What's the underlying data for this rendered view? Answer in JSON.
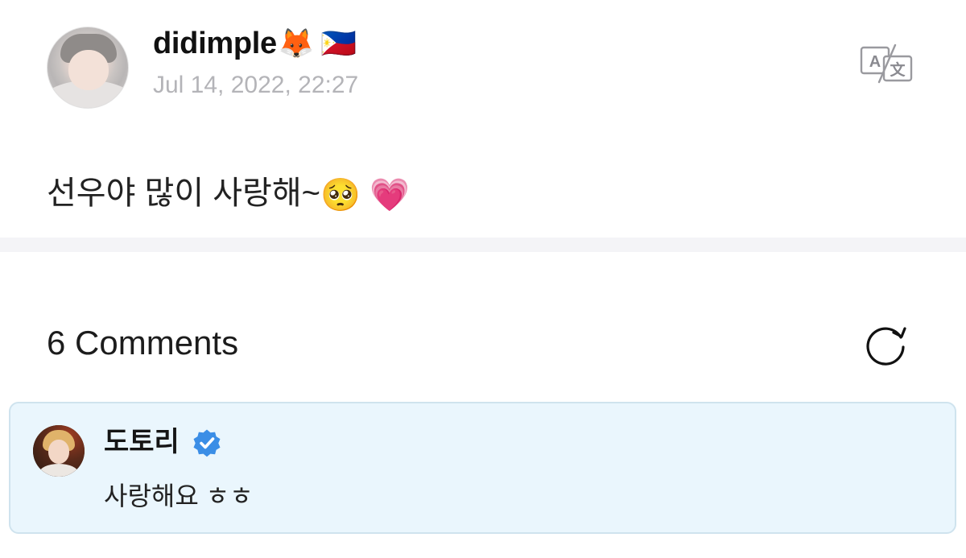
{
  "post": {
    "author": {
      "name": "didimple",
      "badges": [
        "🦊",
        "🇵🇭"
      ],
      "avatar_icon": "user-avatar-photo"
    },
    "timestamp": "Jul 14, 2022, 22:27",
    "translate_icon": "translate-icon",
    "body": {
      "text": "선우야 많이 사랑해~",
      "emojis": [
        "🥺",
        "💗"
      ]
    }
  },
  "comments": {
    "count_label": "6 Comments",
    "refresh_icon": "refresh-icon",
    "items": [
      {
        "author": "도토리",
        "verified": true,
        "verified_icon": "verified-badge-icon",
        "text": "사랑해요 ㅎㅎ",
        "highlight_color": "#eaf6fd"
      }
    ]
  },
  "colors": {
    "timestamp": "#b4b4b8",
    "divider": "#f4f4f7",
    "comment_border": "#cfe3ee",
    "verified_blue": "#3b8ee6"
  }
}
